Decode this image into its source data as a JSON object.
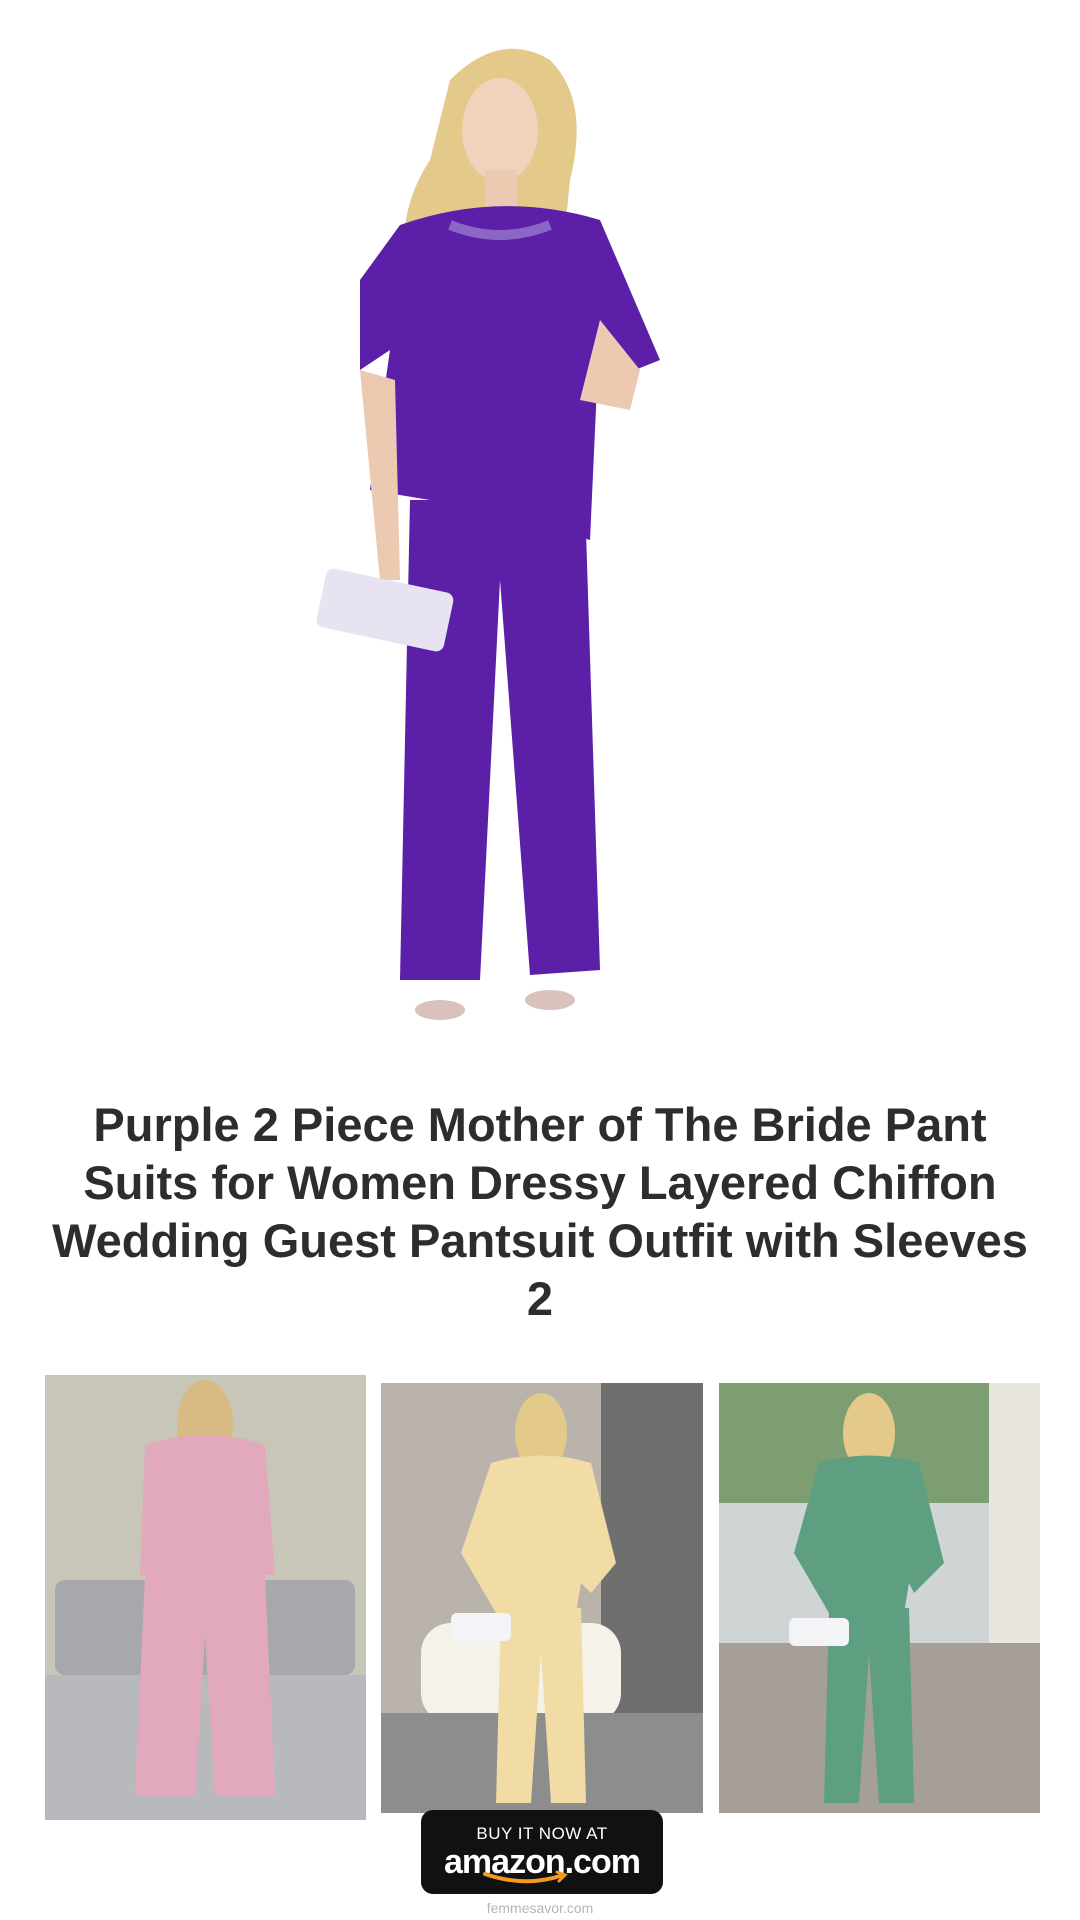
{
  "product": {
    "title": "Purple 2 Piece Mother of The Bride Pant Suits for Women Dressy Layered Chiffon Wedding Guest Pantsuit Outfit with Sleeves 2",
    "main_color": "#5b1fa8"
  },
  "thumbnails": [
    {
      "name": "pink",
      "color": "#e2a9bd"
    },
    {
      "name": "champagne",
      "color": "#f1dca5"
    },
    {
      "name": "sage-green",
      "color": "#5e9f82"
    }
  ],
  "cta": {
    "buy_line": "BUY IT NOW AT",
    "brand_line": "amazon.com",
    "accent": "#f29a1d"
  },
  "footer": {
    "site": "femmesavor.com"
  }
}
